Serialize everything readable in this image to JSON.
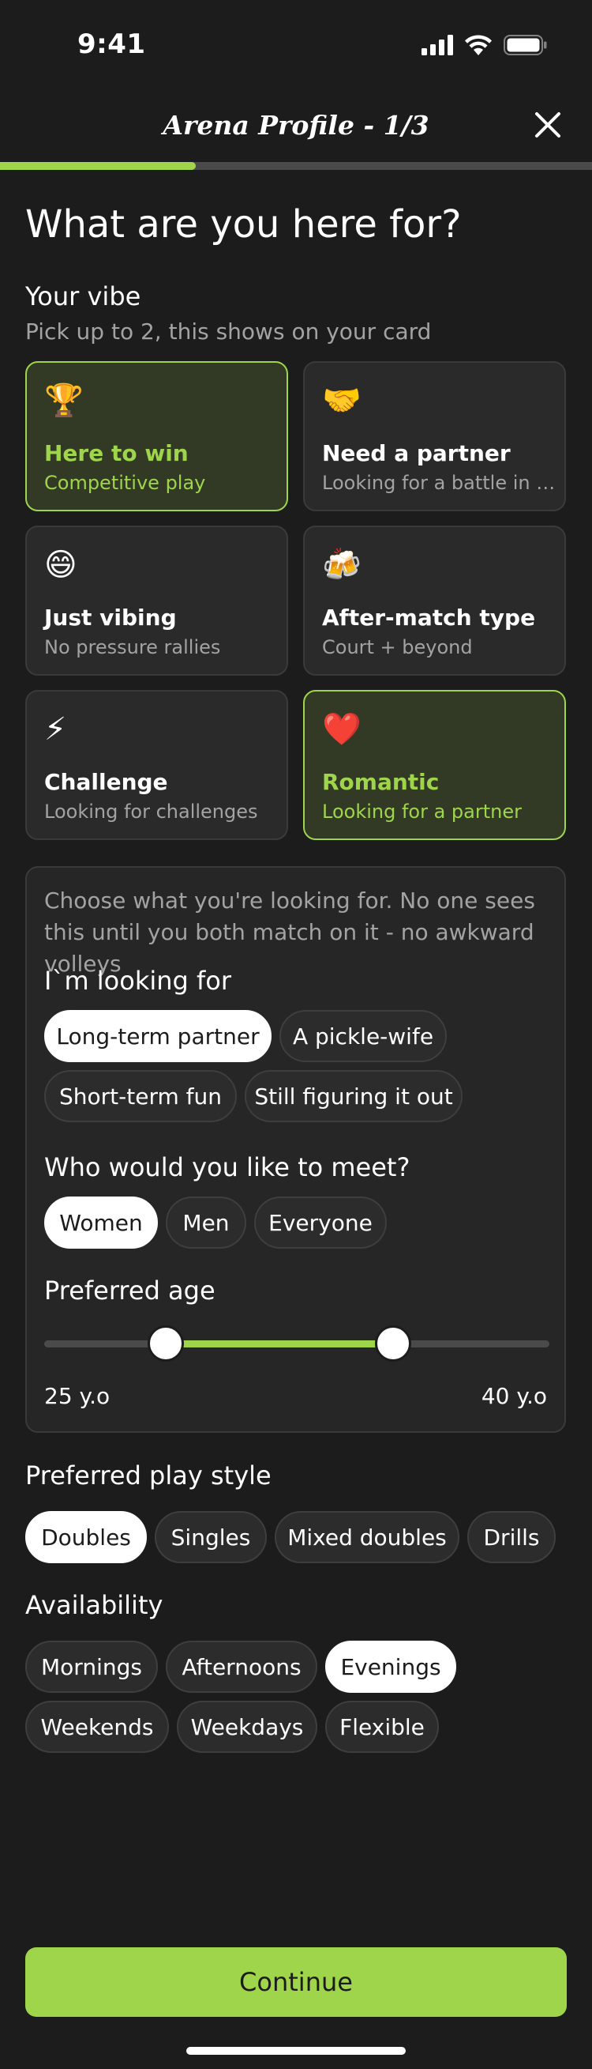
{
  "status_bar": {
    "time": "9:41",
    "icons": [
      "signal-icon",
      "wifi-icon",
      "battery-icon"
    ]
  },
  "header": {
    "title": "Arena Profile - 1/3",
    "close_icon": "close-icon",
    "progress": 0.33
  },
  "page_title": "What are you here for?",
  "vibe": {
    "title": "Your vibe",
    "subtitle": "Pick up to 2, this shows on your card",
    "cards": [
      {
        "emoji": "🏆",
        "title": "Here to win",
        "subtitle": "Competitive play",
        "selected": true
      },
      {
        "emoji": "🤝",
        "title": "Need a partner",
        "subtitle": "Looking for a battle in to...",
        "selected": false
      },
      {
        "emoji": "😄",
        "title": "Just vibing",
        "subtitle": "No pressure rallies",
        "selected": false
      },
      {
        "emoji": "🍻",
        "title": "After-match type",
        "subtitle": "Court + beyond",
        "selected": false
      },
      {
        "emoji": "⚡",
        "title": "Challenge",
        "subtitle": "Looking for challenges",
        "selected": false
      },
      {
        "emoji": "❤️",
        "title": "Romantic",
        "subtitle": "Looking for a partner",
        "selected": true
      }
    ]
  },
  "looking": {
    "description": "Choose what you're looking for. No one sees this until you both match on it - no awkward volleys",
    "title": "I`m looking for",
    "options": [
      {
        "label": "Long-term partner",
        "selected": true
      },
      {
        "label": "A pickle-wife",
        "selected": false
      },
      {
        "label": "Short-term fun",
        "selected": false
      },
      {
        "label": "Still figuring it out",
        "selected": false
      }
    ],
    "meet_title": "Who would you like to meet?",
    "meet_options": [
      {
        "label": "Women",
        "selected": true
      },
      {
        "label": "Men",
        "selected": false
      },
      {
        "label": "Everyone",
        "selected": false
      }
    ],
    "age_title": "Preferred age",
    "age_min_label": "25 y.o",
    "age_max_label": "40 y.o",
    "age_range_fraction": [
      0.24,
      0.69
    ]
  },
  "play_style": {
    "title": "Preferred play style",
    "options": [
      {
        "label": "Doubles",
        "selected": true
      },
      {
        "label": "Singles",
        "selected": false
      },
      {
        "label": "Mixed doubles",
        "selected": false
      },
      {
        "label": "Drills",
        "selected": false
      }
    ]
  },
  "availability": {
    "title": "Availability",
    "options": [
      {
        "label": "Mornings",
        "selected": false
      },
      {
        "label": "Afternoons",
        "selected": false
      },
      {
        "label": "Evenings",
        "selected": true
      },
      {
        "label": "Weekends",
        "selected": false
      },
      {
        "label": "Weekdays",
        "selected": false
      },
      {
        "label": "Flexible",
        "selected": false
      }
    ]
  },
  "continue_label": "Continue",
  "colors": {
    "accent": "#9fd54b",
    "background": "#1c1c1c",
    "card": "#2a2a2a",
    "muted_text": "#a3a3a3"
  }
}
